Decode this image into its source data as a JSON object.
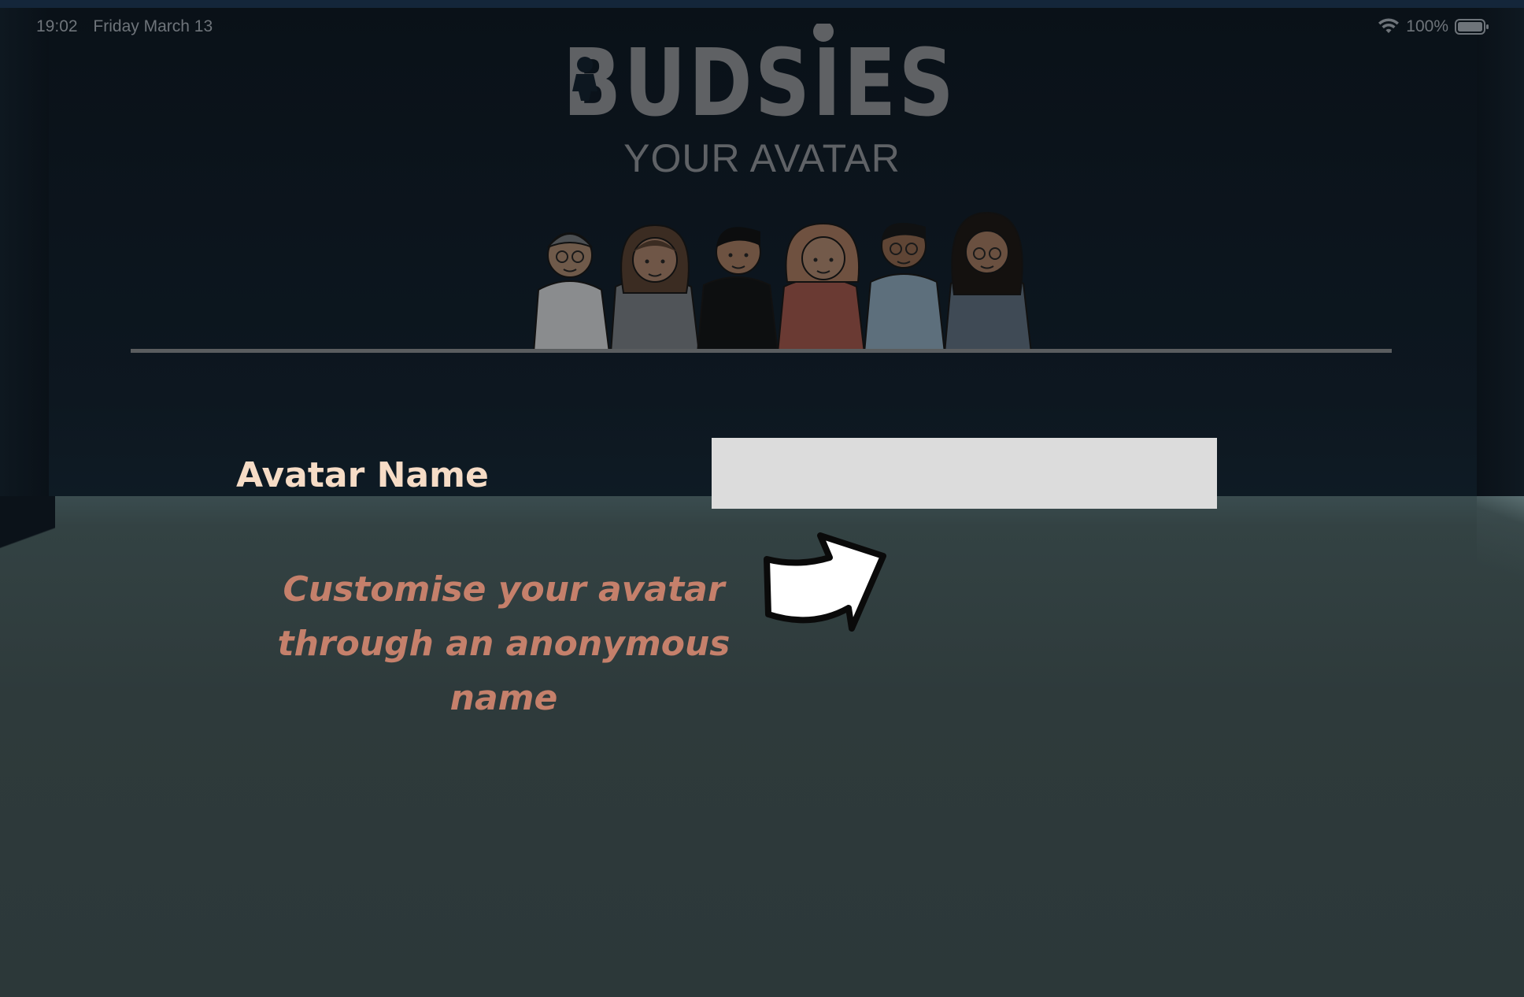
{
  "status_bar": {
    "time": "19:02",
    "date": "Friday March 13",
    "battery": "100%",
    "icons": [
      "wifi-icon",
      "battery-icon"
    ]
  },
  "brand": {
    "logo_text": "BUDSIES"
  },
  "screen": {
    "title": "YOUR AVATAR"
  },
  "form": {
    "name_label": "Avatar Name",
    "name_value": "",
    "name_placeholder": ""
  },
  "hint": {
    "lines": [
      "Customise your avatar",
      "through an anonymous",
      "name"
    ],
    "icon": "arrow-right-icon"
  },
  "avatars": [
    {
      "name": "avatar-1",
      "shirt": "#8a8c8e",
      "hair": "#4c4f52",
      "skin": "#6f5a4a"
    },
    {
      "name": "avatar-2",
      "shirt": "#505458",
      "hair": "#3b2c22",
      "skin": "#6f5647"
    },
    {
      "name": "avatar-3",
      "shirt": "#0d0f10",
      "hair": "#0c0d0e",
      "skin": "#6d5241"
    },
    {
      "name": "avatar-4",
      "shirt": "#6a3a33",
      "hair": "#6f5140",
      "skin": "#735a4a"
    },
    {
      "name": "avatar-5",
      "shirt": "#5d6f7c",
      "hair": "#101112",
      "skin": "#5f4535"
    },
    {
      "name": "avatar-6",
      "shirt": "#3f4a55",
      "hair": "#14110f",
      "skin": "#6a5040"
    }
  ],
  "colors": {
    "label": "#f6dcc6",
    "hint": "#c5806b",
    "input_bg": "#dcdcdc",
    "logo": "#5f6164"
  }
}
